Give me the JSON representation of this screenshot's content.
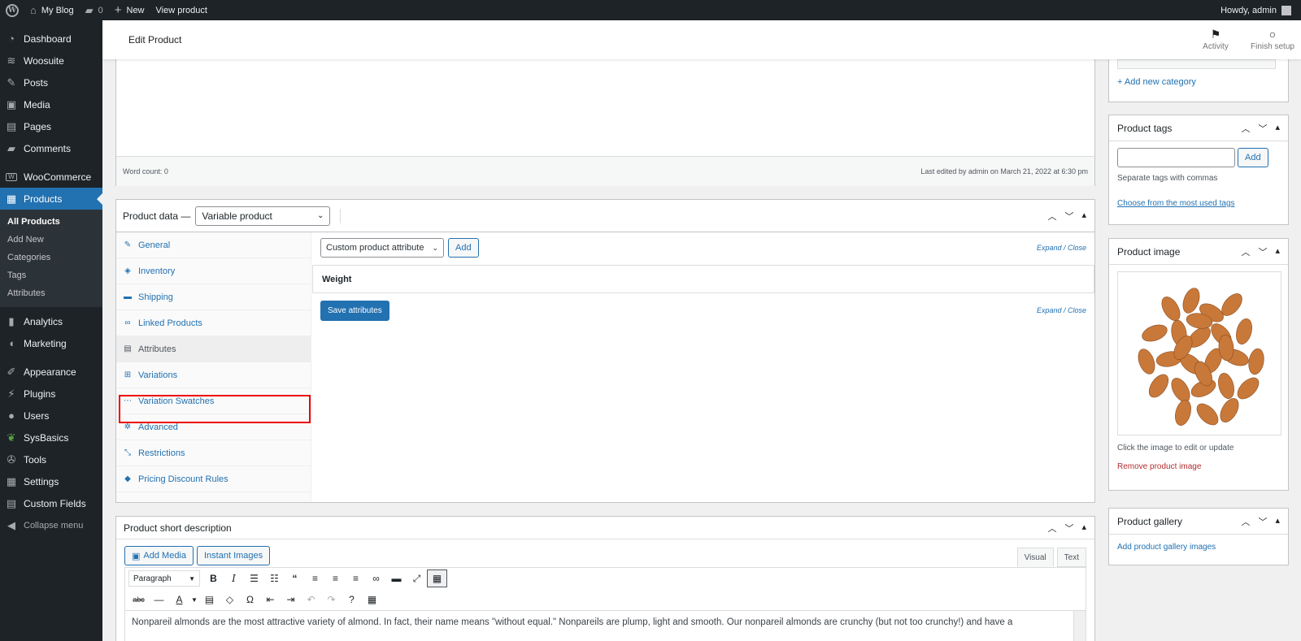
{
  "adminbar": {
    "site_name": "My Blog",
    "comments_count": "0",
    "new_label": "New",
    "view_label": "View product",
    "howdy": "Howdy, admin"
  },
  "sidebar": {
    "items_top": [
      {
        "label": "Dashboard",
        "icon": "dashboard-icon"
      },
      {
        "label": "Woosuite",
        "icon": "woosuite-icon"
      },
      {
        "label": "Posts",
        "icon": "pin-icon"
      },
      {
        "label": "Media",
        "icon": "media-icon"
      },
      {
        "label": "Pages",
        "icon": "page-icon"
      },
      {
        "label": "Comments",
        "icon": "comment-icon"
      }
    ],
    "woocommerce": "WooCommerce",
    "products": "Products",
    "submenu": [
      "All Products",
      "Add New",
      "Categories",
      "Tags",
      "Attributes"
    ],
    "items_bottom": [
      {
        "label": "Analytics",
        "icon": "chart-icon"
      },
      {
        "label": "Marketing",
        "icon": "megaphone-icon"
      },
      {
        "label": "Appearance",
        "icon": "brush-icon"
      },
      {
        "label": "Plugins",
        "icon": "plug-icon"
      },
      {
        "label": "Users",
        "icon": "user-icon"
      },
      {
        "label": "SysBasics",
        "icon": "sysbasics-icon"
      },
      {
        "label": "Tools",
        "icon": "wrench-icon"
      },
      {
        "label": "Settings",
        "icon": "settings-icon"
      },
      {
        "label": "Custom Fields",
        "icon": "fields-icon"
      }
    ],
    "collapse": "Collapse menu"
  },
  "header": {
    "title": "Edit Product",
    "activity": "Activity",
    "finish_setup": "Finish setup"
  },
  "editor": {
    "word_count": "Word count: 0",
    "last_edited": "Last edited by admin on March 21, 2022 at 6:30 pm"
  },
  "product_data": {
    "label": "Product data —",
    "type": "Variable product",
    "tabs": [
      "General",
      "Inventory",
      "Shipping",
      "Linked Products",
      "Attributes",
      "Variations",
      "Variation Swatches",
      "Advanced",
      "Restrictions",
      "Pricing Discount Rules"
    ],
    "attribute_select": "Custom product attribute",
    "add": "Add",
    "expand_close": "Expand / Close",
    "attribute_name": "Weight",
    "save_attributes": "Save attributes"
  },
  "short_description": {
    "title": "Product short description",
    "add_media": "Add Media",
    "instant_images": "Instant Images",
    "visual": "Visual",
    "text": "Text",
    "format": "Paragraph",
    "content": "Nonpareil almonds are the most attractive variety of almond. In fact, their name means \"without equal.\" Nonpareils are plump, light and smooth.  Our nonpareil almonds are crunchy (but not too crunchy!) and have a"
  },
  "right": {
    "add_category": "+ Add new category",
    "tags_title": "Product tags",
    "tags_add": "Add",
    "tags_hint": "Separate tags with commas",
    "tags_choose": "Choose from the most used tags",
    "image_title": "Product image",
    "image_hint": "Click the image to edit or update",
    "image_remove": "Remove product image",
    "gallery_title": "Product gallery",
    "gallery_add": "Add product gallery images"
  },
  "colors": {
    "accent": "#2271b1",
    "admin_dark": "#1d2327",
    "highlight": "#ee0000",
    "danger": "#b32d2e"
  }
}
